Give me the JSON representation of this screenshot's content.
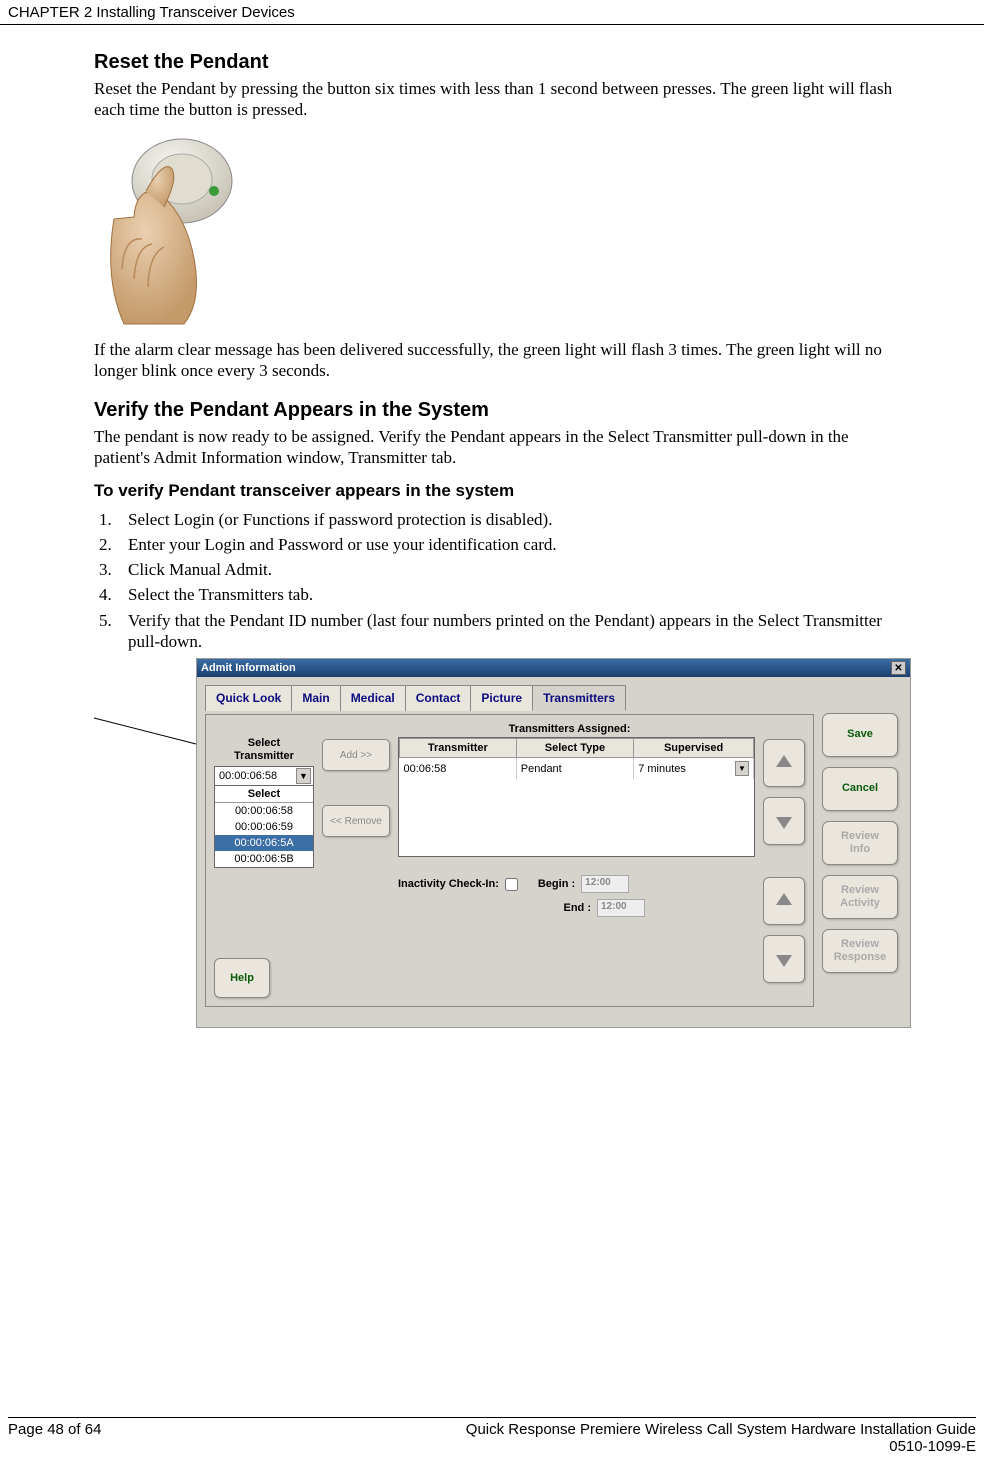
{
  "header": "CHAPTER 2 Installing Transceiver Devices",
  "section1": {
    "title": "Reset the Pendant",
    "p1": "Reset the Pendant by pressing the button six times with less than 1 second between presses. The green light will flash each time the button is pressed.",
    "p2": "If the alarm clear message has been delivered successfully, the green light will flash 3 times. The green light will no longer blink once every 3 seconds."
  },
  "section2": {
    "title": "Verify the Pendant Appears in the System",
    "p1": "The pendant is now ready to be assigned. Verify the Pendant appears in the Select Transmitter  pull-down  in the patient's Admit Information window, Transmitter tab.",
    "subtitle": "To verify Pendant transceiver appears in the system",
    "steps": [
      "Select Login (or Functions if password protection is disabled).",
      "Enter your Login and Password or use your identification card.",
      "Click Manual Admit.",
      "Select the Transmitters tab.",
      "Verify that the Pendant ID number (last four numbers printed on the Pendant) appears in the Select Transmitter pull-down."
    ]
  },
  "admit": {
    "title": "Admit Information",
    "tabs": [
      "Quick Look",
      "Main",
      "Medical",
      "Contact",
      "Picture",
      "Transmitters"
    ],
    "assignedLabel": "Transmitters Assigned:",
    "selectTransLabel": "Select Transmitter",
    "selectedValue": "00:00:06:58",
    "dropdownHeader": "Select",
    "options": [
      "00:00:06:58",
      "00:00:06:59",
      "00:00:06:5A",
      "00:00:06:5B"
    ],
    "addBtn": "Add >>",
    "removeBtn": "<< Remove",
    "tableHeaders": [
      "Transmitter",
      "Select Type",
      "Supervised"
    ],
    "tableRow": {
      "transmitter": "00:06:58",
      "type": "Pendant",
      "supervised": "7 minutes"
    },
    "inactivityLabel": "Inactivity Check-In:",
    "beginLabel": "Begin :",
    "endLabel": "End :",
    "timeValue": "12:00",
    "helpBtn": "Help",
    "rightButtons": [
      "Save",
      "Cancel",
      "Review Info",
      "Review Activity",
      "Review Response"
    ]
  },
  "footer": {
    "left": "Page 48 of 64",
    "right1": "Quick Response Premiere Wireless Call System Hardware Installation Guide",
    "right2": "0510-1099-E"
  }
}
